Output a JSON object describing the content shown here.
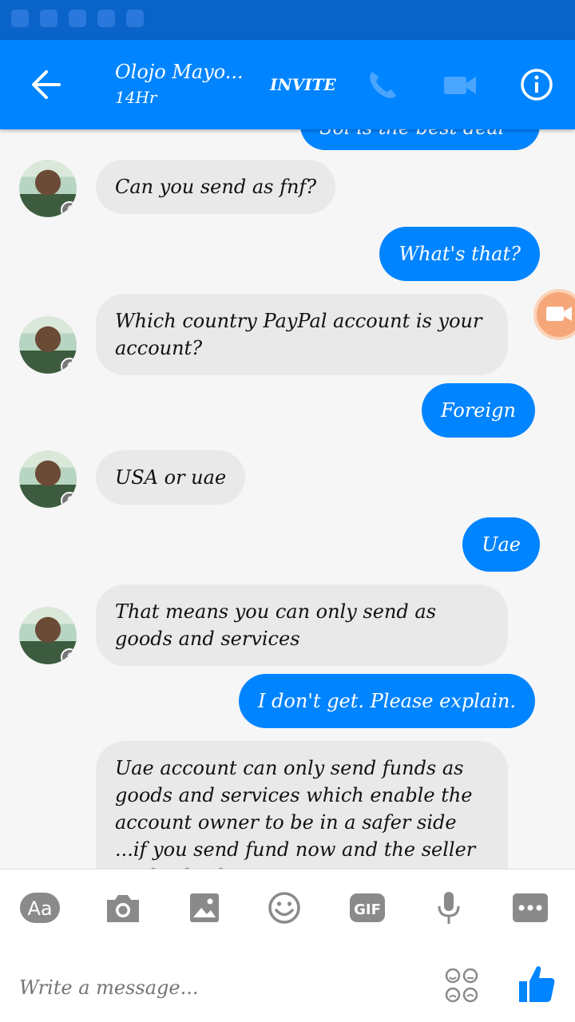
{
  "header": {
    "contact_name": "Olojo Mayo...",
    "status": "14Hr",
    "invite_label": "INVITE"
  },
  "messages": [
    {
      "from": "me",
      "text": "Sol is the best deal ya"
    },
    {
      "from": "them",
      "text": "Can you send as fnf?"
    },
    {
      "from": "me",
      "text": "What's that?"
    },
    {
      "from": "them",
      "text": "Which country PayPal account is your account?"
    },
    {
      "from": "me",
      "text": "Foreign"
    },
    {
      "from": "them",
      "text": "USA or uae"
    },
    {
      "from": "me",
      "text": "Uae"
    },
    {
      "from": "them",
      "text": "That means you can only send as goods and services"
    },
    {
      "from": "me",
      "text": "I don't get. Please explain."
    },
    {
      "from": "them",
      "text": "Uae  account can only send funds as goods and services which enable the account owner to be in a safer side ...if you send fund now and the seller or the fund"
    }
  ],
  "composer": {
    "placeholder": "Write a message..."
  },
  "toolbar": {
    "text_label": "Aa",
    "gif_label": "GIF"
  }
}
